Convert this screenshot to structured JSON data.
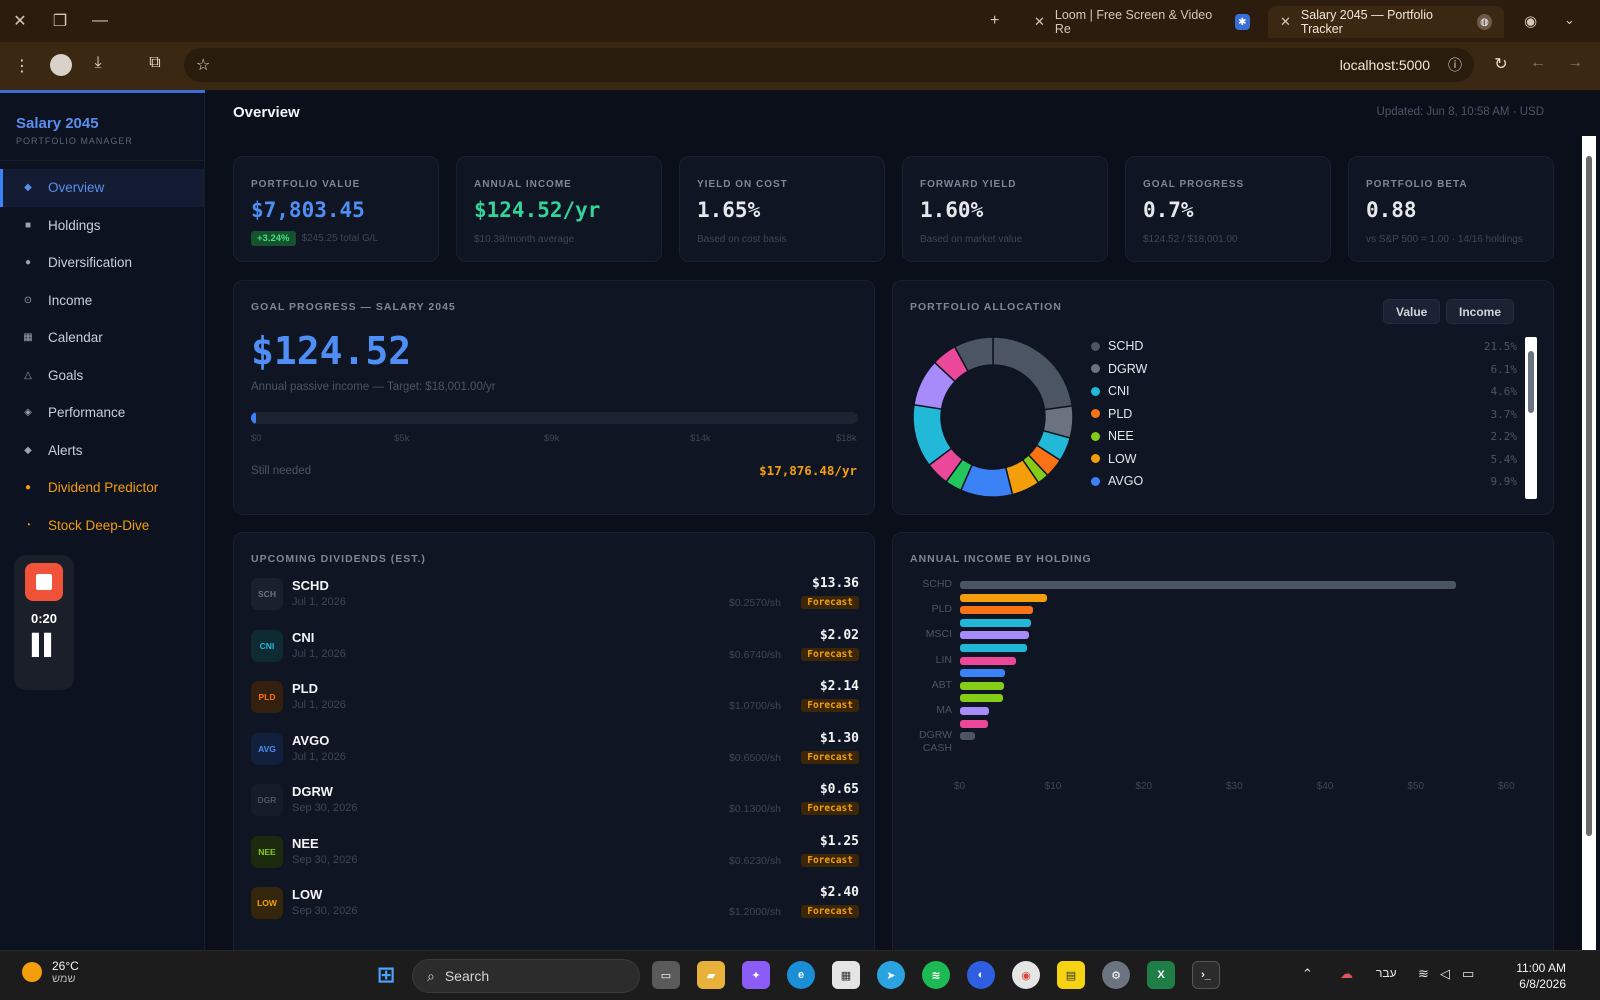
{
  "browser": {
    "tabs": [
      {
        "title": "Loom | Free Screen & Video Re",
        "active": false
      },
      {
        "title": "Salary 2045 — Portfolio Tracker",
        "active": true
      }
    ],
    "url": "localhost:5000"
  },
  "sidebar": {
    "brand_title": "Salary 2045",
    "brand_sub": "PORTFOLIO MANAGER",
    "items": [
      {
        "label": "Overview",
        "icon": "◆"
      },
      {
        "label": "Holdings",
        "icon": "■"
      },
      {
        "label": "Diversification",
        "icon": "●"
      },
      {
        "label": "Income",
        "icon": "⊙"
      },
      {
        "label": "Calendar",
        "icon": "▦"
      },
      {
        "label": "Goals",
        "icon": "△"
      },
      {
        "label": "Performance",
        "icon": "◈"
      },
      {
        "label": "Alerts",
        "icon": "◆"
      },
      {
        "label": "Dividend Predictor",
        "icon": "●"
      },
      {
        "label": "Stock Deep-Dive",
        "icon": "◔"
      }
    ]
  },
  "loom": {
    "time": "0:20"
  },
  "header": {
    "title": "Overview",
    "updated": "Updated: Jun 8, 10:58 AM · USD"
  },
  "kpis": [
    {
      "label": "PORTFOLIO VALUE",
      "value": "$7,803.45",
      "badge": "+3.24%",
      "sub": "$245.25 total G/L",
      "color": "#4f8ef5"
    },
    {
      "label": "ANNUAL INCOME",
      "value": "$124.52/yr",
      "sub": "$10.38/month average",
      "color": "#34d399"
    },
    {
      "label": "YIELD ON COST",
      "value": "1.65%",
      "sub": "Based on cost basis",
      "color": "#f3f4f6"
    },
    {
      "label": "FORWARD YIELD",
      "value": "1.60%",
      "sub": "Based on market value",
      "color": "#f3f4f6"
    },
    {
      "label": "GOAL PROGRESS",
      "value": "0.7%",
      "sub": "$124.52 / $18,001.00",
      "color": "#f3f4f6"
    },
    {
      "label": "PORTFOLIO BETA",
      "value": "0.88",
      "sub": "vs S&P 500 = 1.00 · 14/16 holdings",
      "color": "#f3f4f6"
    }
  ],
  "goal": {
    "label": "GOAL PROGRESS — SALARY 2045",
    "amount": "$124.52",
    "sub": "Annual passive income — Target: $18,001.00/yr",
    "progress": 0.007,
    "ticks": [
      "$0",
      "$5k",
      "$9k",
      "$14k",
      "$18k"
    ],
    "need_label": "Still needed",
    "need_value": "$17,876.48/yr"
  },
  "allocation": {
    "label": "PORTFOLIO ALLOCATION",
    "btn_value": "Value",
    "btn_income": "Income",
    "legend": [
      {
        "name": "SCHD",
        "pct": "21.5%",
        "color": "#4b5563"
      },
      {
        "name": "DGRW",
        "pct": "6.1%",
        "color": "#6b7280"
      },
      {
        "name": "CNI",
        "pct": "4.6%",
        "color": "#22b8d8"
      },
      {
        "name": "PLD",
        "pct": "3.7%",
        "color": "#f97316"
      },
      {
        "name": "NEE",
        "pct": "2.2%",
        "color": "#84cc16"
      },
      {
        "name": "LOW",
        "pct": "5.4%",
        "color": "#f59e0b"
      },
      {
        "name": "AVGO",
        "pct": "9.9%",
        "color": "#3b82f6"
      }
    ]
  },
  "dividends": {
    "label": "UPCOMING DIVIDENDS (EST.)",
    "rows": [
      {
        "abbr": "SCH",
        "ticker": "SCHD",
        "date": "Jul 1, 2026",
        "amount": "$13.36",
        "per": "$0.2570/sh",
        "tag": "Forecast",
        "fg": "#6b7280",
        "bg": "#1a202c"
      },
      {
        "abbr": "CNI",
        "ticker": "CNI",
        "date": "Jul 1, 2026",
        "amount": "$2.02",
        "per": "$0.6740/sh",
        "tag": "Forecast",
        "fg": "#22b8d8",
        "bg": "#0e2a33"
      },
      {
        "abbr": "PLD",
        "ticker": "PLD",
        "date": "Jul 1, 2026",
        "amount": "$2.14",
        "per": "$1.0700/sh",
        "tag": "Forecast",
        "fg": "#f97316",
        "bg": "#33200e"
      },
      {
        "abbr": "AVG",
        "ticker": "AVGO",
        "date": "Jul 1, 2026",
        "amount": "$1.30",
        "per": "$0.6500/sh",
        "tag": "Forecast",
        "fg": "#4f8ef5",
        "bg": "#10203d"
      },
      {
        "abbr": "DGR",
        "ticker": "DGRW",
        "date": "Sep 30, 2026",
        "amount": "$0.65",
        "per": "$0.1300/sh",
        "tag": "Forecast",
        "fg": "#4b5563",
        "bg": "#161c27"
      },
      {
        "abbr": "NEE",
        "ticker": "NEE",
        "date": "Sep 30, 2026",
        "amount": "$1.25",
        "per": "$0.6230/sh",
        "tag": "Forecast",
        "fg": "#84cc16",
        "bg": "#1c2a0e"
      },
      {
        "abbr": "LOW",
        "ticker": "LOW",
        "date": "Sep 30, 2026",
        "amount": "$2.40",
        "per": "$1.2000/sh",
        "tag": "Forecast",
        "fg": "#f59e0b",
        "bg": "#33260a"
      }
    ]
  },
  "chart_data": {
    "type": "bar",
    "orientation": "horizontal",
    "title": "ANNUAL INCOME BY HOLDING",
    "categories": [
      "SCHD",
      "",
      "PLD",
      "",
      "MSCI",
      "",
      "LIN",
      "",
      "ABT",
      "",
      "MA",
      "",
      "DGRW",
      "CASH"
    ],
    "values": [
      54.7,
      9.6,
      8.1,
      7.8,
      7.6,
      7.4,
      6.2,
      5.0,
      4.8,
      4.7,
      3.2,
      3.1,
      1.7,
      0
    ],
    "colors": [
      "#4b5563",
      "#f59e0b",
      "#f97316",
      "#22b8d8",
      "#a78bfa",
      "#22b8d8",
      "#ec4899",
      "#3b82f6",
      "#84cc16",
      "#84cc16",
      "#a78bfa",
      "#ec4899",
      "#4b5563",
      "#4b5563"
    ],
    "x_ticks": [
      "$0",
      "$10",
      "$20",
      "$30",
      "$40",
      "$50",
      "$60"
    ],
    "xlim": [
      0,
      60
    ]
  },
  "donut": {
    "slices": [
      {
        "value": 21.5,
        "color": "#4b5563"
      },
      {
        "value": 6.1,
        "color": "#6b7280"
      },
      {
        "value": 4.6,
        "color": "#22b8d8"
      },
      {
        "value": 3.7,
        "color": "#f97316"
      },
      {
        "value": 2.2,
        "color": "#84cc16"
      },
      {
        "value": 5.4,
        "color": "#f59e0b"
      },
      {
        "value": 9.9,
        "color": "#3b82f6"
      },
      {
        "value": 3.2,
        "color": "#22c55e"
      },
      {
        "value": 4.5,
        "color": "#ec4899"
      },
      {
        "value": 12.0,
        "color": "#22b8d8"
      },
      {
        "value": 9.0,
        "color": "#a78bfa"
      },
      {
        "value": 4.8,
        "color": "#ec4899"
      },
      {
        "value": 7.5,
        "color": "#4b5563"
      }
    ]
  },
  "taskbar": {
    "temp": "26°C",
    "cond": "שמש",
    "search": "Search",
    "lang": "עבר",
    "time": "11:00 AM",
    "date": "6/8/2026"
  }
}
